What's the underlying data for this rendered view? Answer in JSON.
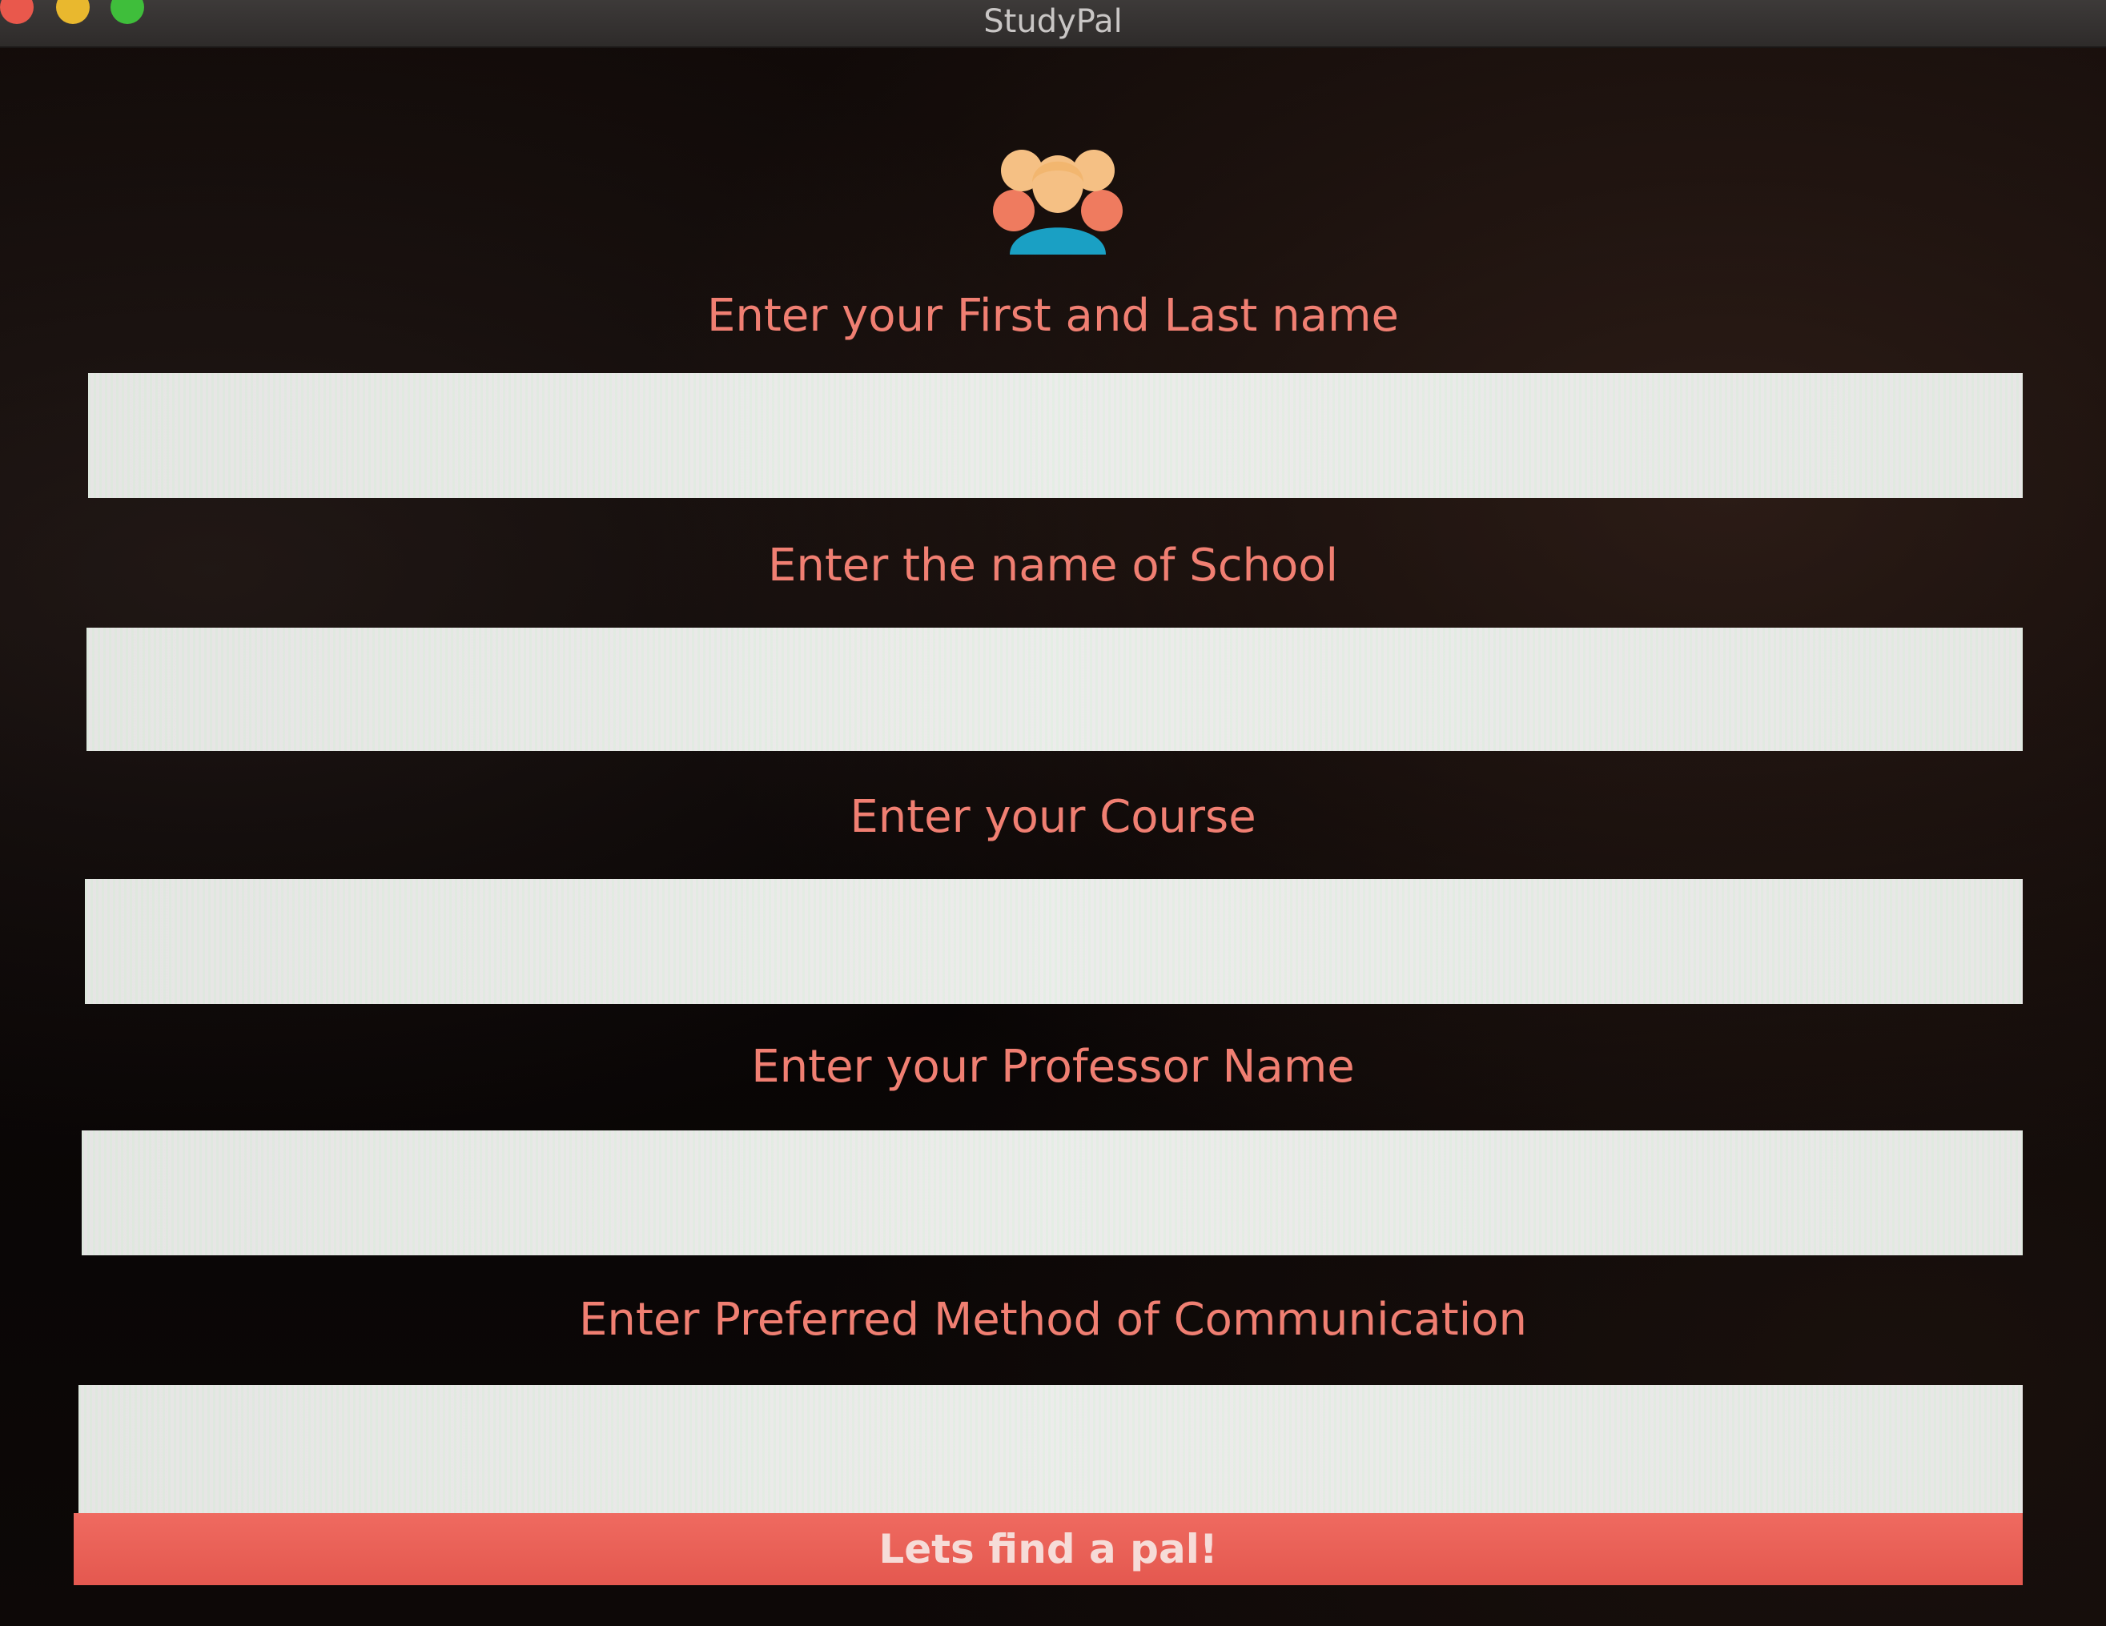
{
  "window": {
    "title": "StudyPal",
    "controls": [
      "close",
      "minimize",
      "zoom"
    ]
  },
  "logo": {
    "icon": "group-people-icon",
    "colors": {
      "head": "#f5c084",
      "side_people": "#ef7b5f",
      "center_body": "#1aa0c4"
    }
  },
  "form": {
    "fields": [
      {
        "label": "Enter your First and Last name",
        "value": "",
        "placeholder": ""
      },
      {
        "label": "Enter the name of School",
        "value": "",
        "placeholder": ""
      },
      {
        "label": "Enter your Course",
        "value": "",
        "placeholder": ""
      },
      {
        "label": "Enter your Professor Name",
        "value": "",
        "placeholder": ""
      },
      {
        "label": "Enter Preferred Method of Communication",
        "value": "",
        "placeholder": ""
      }
    ],
    "submit_label": "Lets find a pal!"
  },
  "colors": {
    "accent": "#ef6a60",
    "label_text": "#f07f72",
    "background": "#070404",
    "input_background": "#eceee9"
  }
}
